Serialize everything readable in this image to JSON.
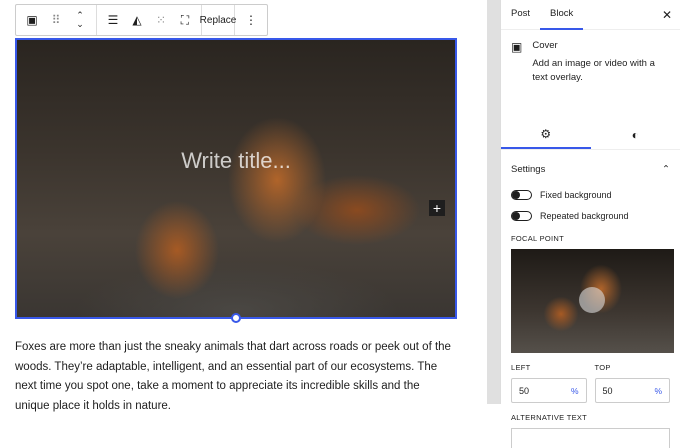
{
  "toolbar": {
    "replace_label": "Replace"
  },
  "cover": {
    "title_placeholder": "Write title..."
  },
  "paragraph": "Foxes are more than just the sneaky animals that dart across roads or peek out of the woods. They’re adaptable, intelligent, and an essential part of our ecosystems. The next time you spot one, take a moment to appreciate its incredible skills and the unique place it holds in nature.",
  "sidebar": {
    "tabs": [
      "Post",
      "Block"
    ],
    "block_name": "Cover",
    "block_desc": "Add an image or video with a text overlay.",
    "settings_title": "Settings",
    "fixed_bg": "Fixed background",
    "repeated_bg": "Repeated background",
    "focal_label": "Focal point",
    "left_label": "Left",
    "left_value": "50",
    "top_label": "Top",
    "top_value": "50",
    "unit": "%",
    "alt_label": "Alternative text"
  },
  "colors": {
    "accent": "#3858e9"
  }
}
